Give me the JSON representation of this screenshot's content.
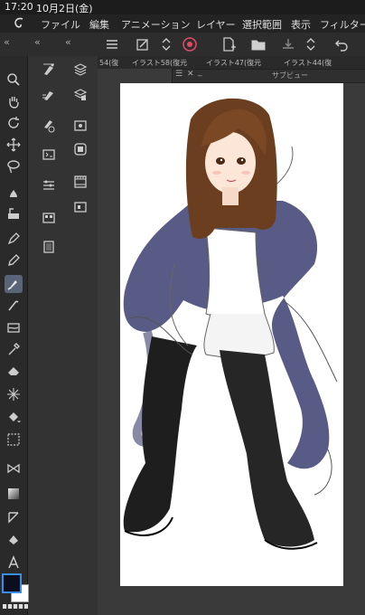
{
  "status": {
    "time": "17:20",
    "date": "10月2日(金)"
  },
  "menu": {
    "items": [
      "ファイル",
      "編集",
      "アニメーション",
      "レイヤー",
      "選択範囲",
      "表示",
      "フィルター"
    ]
  },
  "tabs": [
    "54(復",
    "イラスト58(復元",
    "イラスト47(復元",
    "イラスト44(復"
  ],
  "subview": {
    "title": "サブビュー"
  },
  "colors": {
    "foreground": "#0b0e1c",
    "background": "#ffffff",
    "accent": "#3a8ee8"
  },
  "icons": {
    "tools": [
      "zoom-icon",
      "hand-icon",
      "rotate-icon",
      "move-icon",
      "lasso-icon",
      "eyedropper-icon",
      "fill-icon",
      "pen-icon",
      "pencil-icon",
      "brush-icon",
      "airbrush-icon",
      "watercolor-icon",
      "blend-icon",
      "dropper-icon",
      "eraser-icon",
      "sparkle-icon",
      "bucket-icon",
      "gradient-icon",
      "figure-icon",
      "frame-icon",
      "ruler-icon",
      "text-icon"
    ]
  }
}
